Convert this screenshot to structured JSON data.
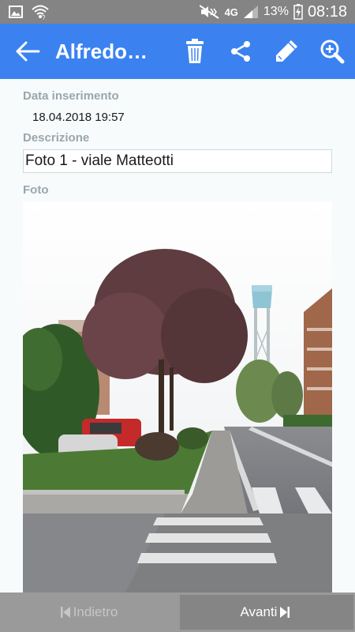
{
  "status_bar": {
    "network": "4G",
    "battery": "13%",
    "time": "08:18"
  },
  "app_bar": {
    "title": "Alfredo…",
    "icons": [
      "arrow-left-icon",
      "trash-icon",
      "share-icon",
      "pencil-icon",
      "zoom-in-icon"
    ]
  },
  "form": {
    "date_label": "Data inserimento",
    "date_value": "18.04.2018 19:57",
    "description_label": "Descrizione",
    "description_value": "Foto 1 - viale Matteotti",
    "photo_label": "Foto"
  },
  "bottom_bar": {
    "prev_label": "Indietro",
    "next_label": "Avanti"
  },
  "colors": {
    "app_bar": "#3b82f0",
    "status_bar": "#848484",
    "label": "#9aa6ad"
  }
}
